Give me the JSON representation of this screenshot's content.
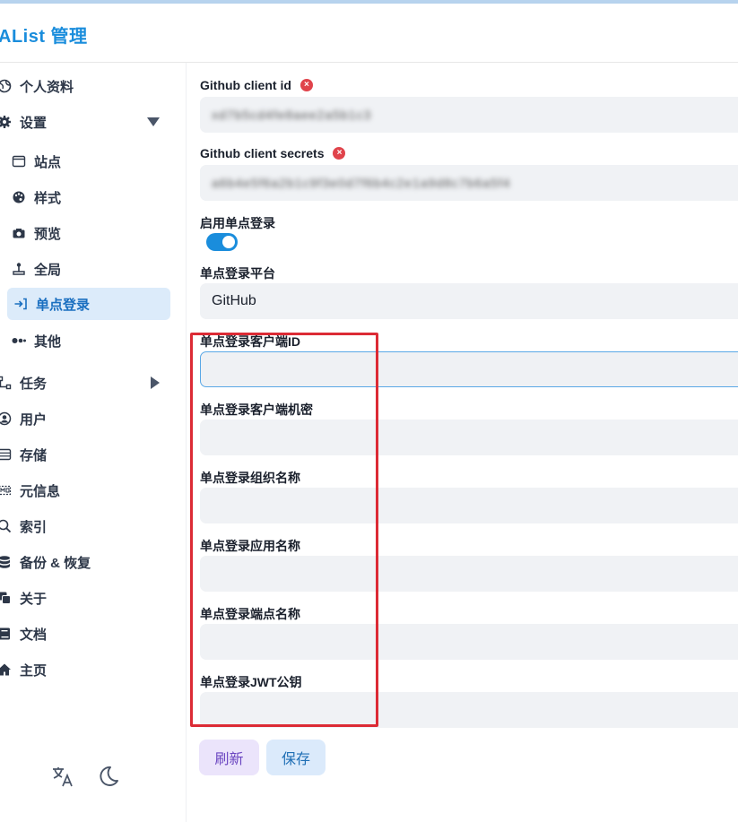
{
  "header": {
    "title": "AList 管理"
  },
  "sidebar": {
    "items": [
      {
        "label": "个人资料",
        "icon": "globe-icon"
      },
      {
        "label": "设置",
        "icon": "gear-icon"
      },
      {
        "label": "站点",
        "icon": "window-icon"
      },
      {
        "label": "样式",
        "icon": "palette-icon"
      },
      {
        "label": "预览",
        "icon": "camera-icon"
      },
      {
        "label": "全局",
        "icon": "joystick-icon"
      },
      {
        "label": "单点登录",
        "icon": "sign-in-icon"
      },
      {
        "label": "其他",
        "icon": "dots-icon"
      },
      {
        "label": "任务",
        "icon": "tasks-icon"
      },
      {
        "label": "用户",
        "icon": "user-icon"
      },
      {
        "label": "存储",
        "icon": "storage-icon"
      },
      {
        "label": "元信息",
        "icon": "meta-icon"
      },
      {
        "label": "索引",
        "icon": "search-icon"
      },
      {
        "label": "备份 & 恢复",
        "icon": "database-icon"
      },
      {
        "label": "关于",
        "icon": "copy-icon"
      },
      {
        "label": "文档",
        "icon": "book-icon"
      },
      {
        "label": "主页",
        "icon": "home-icon"
      }
    ],
    "active": "单点登录"
  },
  "form": {
    "github_client_id": {
      "label": "Github client id",
      "value": "xd7b5cd4fe8aee2a5b1c3"
    },
    "github_client_secrets": {
      "label": "Github client secrets",
      "value": "a6b4e5f6a2b1c9f3e0d7f6b4c2e1a9d8c7b6a5f4"
    },
    "sso_enable": {
      "label": "启用单点登录",
      "enabled": true
    },
    "sso_platform": {
      "label": "单点登录平台",
      "value": "GitHub"
    },
    "sso_client_id": {
      "label": "单点登录客户端ID",
      "value": ""
    },
    "sso_client_secret": {
      "label": "单点登录客户端机密",
      "value": ""
    },
    "sso_org_name": {
      "label": "单点登录组织名称",
      "value": ""
    },
    "sso_app_name": {
      "label": "单点登录应用名称",
      "value": ""
    },
    "sso_endpoint_name": {
      "label": "单点登录端点名称",
      "value": ""
    },
    "sso_jwt_public_key": {
      "label": "单点登录JWT公钥",
      "value": ""
    }
  },
  "buttons": {
    "refresh": "刷新",
    "save": "保存"
  },
  "colors": {
    "accent": "#1a8ddc",
    "highlight": "#dc2b35",
    "error": "#e0434b"
  }
}
